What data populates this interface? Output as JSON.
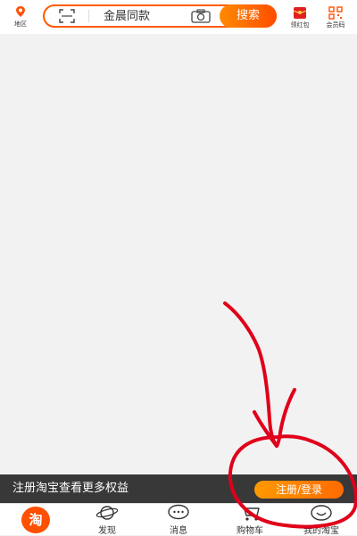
{
  "header": {
    "region_label": "地区",
    "search_query": "金晨同款",
    "search_button": "搜索",
    "red_packet_label": "领红包",
    "pay_code_label": "会员码"
  },
  "login_banner": {
    "message": "注册淘宝查看更多权益",
    "button": "注册/登录"
  },
  "bottom_nav": {
    "home_glyph": "淘",
    "tabs": [
      "发现",
      "消息",
      "购物车",
      "我的淘宝"
    ]
  },
  "colors": {
    "accent": "#ff5000",
    "annotation": "#e0001a"
  },
  "icons": [
    "location-icon",
    "scan-icon",
    "camera-icon",
    "red-packet-icon",
    "qr-code-icon",
    "planet-icon",
    "message-icon",
    "cart-icon",
    "smile-icon"
  ]
}
